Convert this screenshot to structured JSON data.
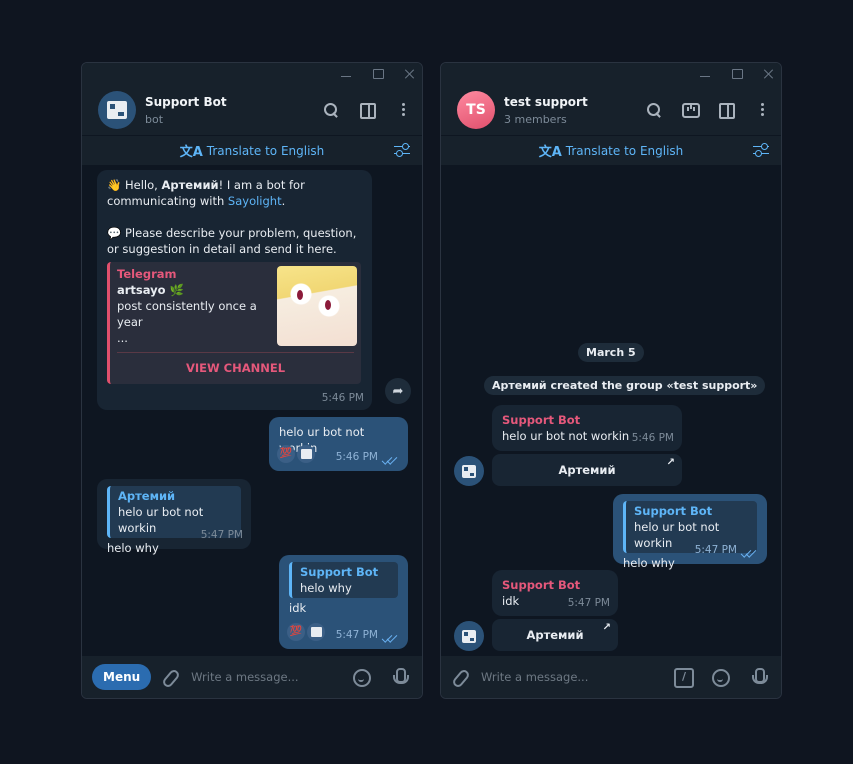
{
  "window_left": {
    "header": {
      "title": "Support Bot",
      "subtitle": "bot"
    },
    "translate": {
      "glyph": "文A",
      "label": "Translate to English"
    },
    "messages": {
      "welcome": {
        "wave": "👋",
        "hello": "Hello, ",
        "name": "Артемий",
        "rest1": "! I am a bot for communicating with ",
        "link": "Sayolight",
        "period": ".",
        "speech": "💬",
        "rest2": " Please describe your problem, question, or suggestion in detail and send it here.",
        "preview": {
          "source": "Telegram",
          "title": "artsayo 🌿",
          "desc": "post consistently once a year",
          "ellipsis": "...",
          "button": "VIEW CHANNEL"
        },
        "time": "5:46 PM"
      },
      "out1": {
        "text": "helo ur bot not workin",
        "time": "5:46 PM",
        "reaction": "💯"
      },
      "in2": {
        "reply_name": "Артемий",
        "reply_text": "helo ur bot not workin",
        "text": "helo why",
        "time": "5:47 PM"
      },
      "out2": {
        "reply_name": "Support Bot",
        "reply_text": "helo why",
        "text": "idk",
        "time": "5:47 PM",
        "reaction": "💯"
      }
    },
    "composer": {
      "menu": "Menu",
      "placeholder": "Write a message..."
    }
  },
  "window_right": {
    "header": {
      "avatar": "TS",
      "title": "test support",
      "subtitle": "3 members"
    },
    "translate": {
      "glyph": "文A",
      "label": "Translate to English"
    },
    "date": "March 5",
    "service": "Артемий created the group «test support»",
    "messages": {
      "in1": {
        "name": "Support Bot",
        "text": "helo ur bot not workin",
        "time": "5:46 PM",
        "button": "Артемий",
        "arrow": "↗"
      },
      "out1": {
        "reply_name": "Support Bot",
        "reply_text": "helo ur bot not workin",
        "text": "helo why",
        "time": "5:47 PM"
      },
      "in2": {
        "name": "Support Bot",
        "text": "idk",
        "time": "5:47 PM",
        "button": "Артемий",
        "arrow": "↗"
      }
    },
    "composer": {
      "placeholder": "Write a message..."
    }
  },
  "colors": {
    "background": "#0f1520",
    "panel": "#17212b",
    "incoming": "#182533",
    "outgoing": "#2b5278",
    "accent": "#5eb5f7",
    "pink": "#e5587b"
  }
}
